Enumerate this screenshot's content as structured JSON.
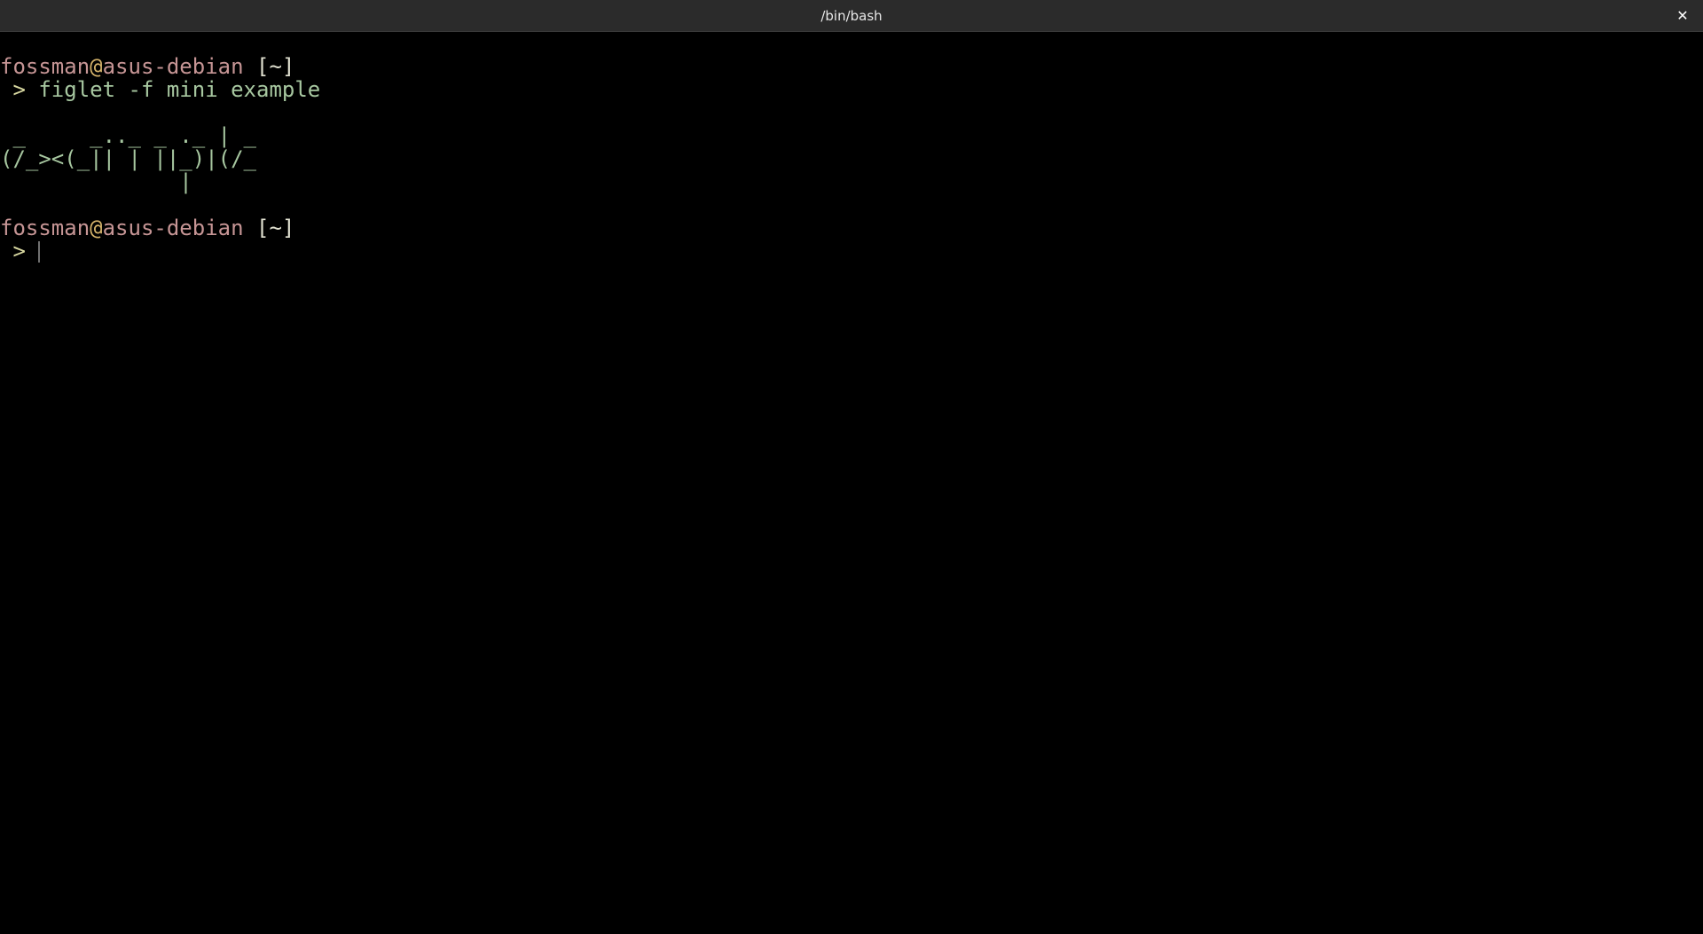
{
  "window": {
    "title": "/bin/bash",
    "close_glyph": "✕"
  },
  "colors": {
    "background": "#000000",
    "titlebar": "#2b2b2b",
    "user": "#c69595",
    "at": "#d4b26a",
    "command": "#a7c7a0"
  },
  "terminal": {
    "prompt1": {
      "user": "fossman",
      "at": "@",
      "host": "asus-debian",
      "dir": " [~]",
      "arrow": " > ",
      "command": "figlet -f mini example"
    },
    "figlet_output": [
      " _     _.._ _ ._ | _ ",
      "(/_><(_|| | ||_)|(/_",
      "              |     "
    ],
    "prompt2": {
      "user": "fossman",
      "at": "@",
      "host": "asus-debian",
      "dir": " [~]",
      "arrow": " > "
    }
  }
}
